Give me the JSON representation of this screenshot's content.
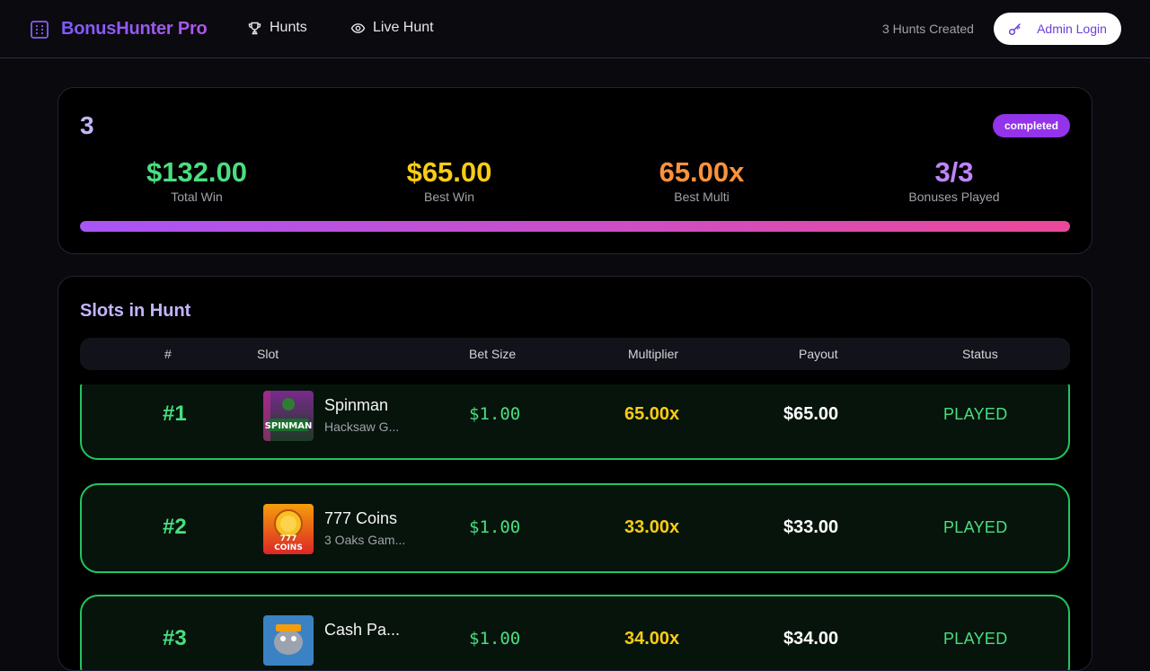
{
  "header": {
    "brand": "BonusHunter Pro",
    "nav": [
      {
        "label": "Hunts",
        "icon": "trophy-icon"
      },
      {
        "label": "Live Hunt",
        "icon": "eye-icon"
      }
    ],
    "hunts_created": "3 Hunts Created",
    "admin_login": "Admin Login"
  },
  "summary": {
    "hunt_number": "3",
    "status": "completed",
    "stats": [
      {
        "value": "$132.00",
        "label": "Total Win",
        "color": "#4ade80"
      },
      {
        "value": "$65.00",
        "label": "Best Win",
        "color": "#facc15"
      },
      {
        "value": "65.00x",
        "label": "Best Multi",
        "color": "#fb923c"
      },
      {
        "value": "3/3",
        "label": "Bonuses Played",
        "color": "#c084fc"
      }
    ],
    "progress_percent": 100
  },
  "slots": {
    "title": "Slots in Hunt",
    "columns": [
      "#",
      "Slot",
      "Bet Size",
      "Multiplier",
      "Payout",
      "Status"
    ],
    "rows": [
      {
        "num": "#1",
        "name": "Spinman",
        "provider": "Hacksaw G...",
        "bet": "$1.00",
        "multiplier": "65.00x",
        "payout": "$65.00",
        "status": "PLAYED",
        "thumb_text": "SPINMAN"
      },
      {
        "num": "#2",
        "name": "777 Coins",
        "provider": "3 Oaks Gam...",
        "bet": "$1.00",
        "multiplier": "33.00x",
        "payout": "$33.00",
        "status": "PLAYED",
        "thumb_text": "777 COINS"
      },
      {
        "num": "#3",
        "name": "Cash Pa...",
        "provider": "",
        "bet": "$1.00",
        "multiplier": "34.00x",
        "payout": "$34.00",
        "status": "PLAYED",
        "thumb_text": ""
      }
    ]
  }
}
